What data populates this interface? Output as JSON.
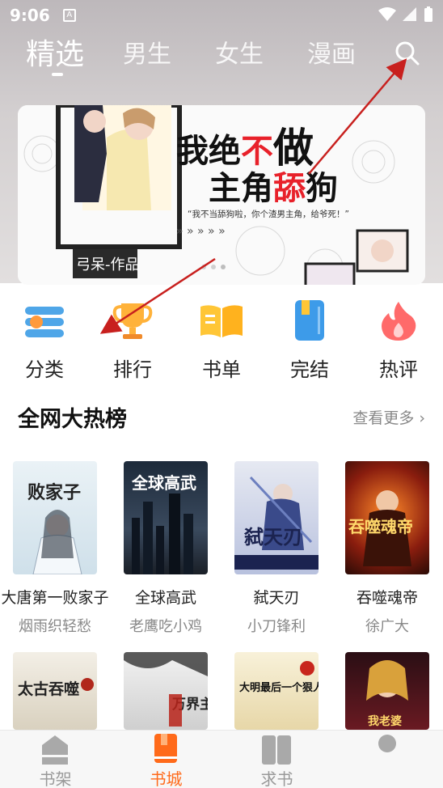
{
  "status_bar": {
    "time": "9:06",
    "notification_glyph": "A"
  },
  "top_tabs": [
    {
      "label": "精选",
      "active": true
    },
    {
      "label": "男生",
      "active": false
    },
    {
      "label": "女生",
      "active": false
    },
    {
      "label": "漫画",
      "active": false
    }
  ],
  "banner": {
    "title_line1_a": "我绝",
    "title_line1_b": "不",
    "title_line1_c": "做",
    "title_line2_a": "主角",
    "title_line2_b": "舔",
    "title_line2_c": "狗",
    "quote": "“我不当舔狗啦，你个渣男主角，给爷死！”",
    "arrows": "» » » » »",
    "author_tag": "弓呆-作品"
  },
  "categories": [
    {
      "label": "分类",
      "icon": "category-icon"
    },
    {
      "label": "排行",
      "icon": "trophy-icon"
    },
    {
      "label": "书单",
      "icon": "booklist-icon"
    },
    {
      "label": "完结",
      "icon": "completed-icon"
    },
    {
      "label": "热评",
      "icon": "hot-comment-icon"
    }
  ],
  "section": {
    "title": "全网大热榜",
    "more": "查看更多 ›"
  },
  "books_row1": [
    {
      "title": "大唐第一败家子",
      "author": "烟雨织轻愁",
      "cover_text": "败家子"
    },
    {
      "title": "全球高武",
      "author": "老鹰吃小鸡",
      "cover_text": "全球高武"
    },
    {
      "title": "弑天刃",
      "author": "小刀锋利",
      "cover_text": "弑天刃"
    },
    {
      "title": "吞噬魂帝",
      "author": "徐广大",
      "cover_text": "吞噬魂帝"
    }
  ],
  "books_row2": [
    {
      "cover_text": "太古吞噬"
    },
    {
      "cover_text": "万界主宰"
    },
    {
      "cover_text": "大明最后一个狠人"
    },
    {
      "cover_text": "我老婆"
    }
  ],
  "bottom_nav": [
    {
      "label": "书架",
      "active": false
    },
    {
      "label": "书城",
      "active": true
    },
    {
      "label": "求书",
      "active": false
    },
    {
      "label": "",
      "active": false
    }
  ],
  "colors": {
    "accent": "#ff6a1a",
    "banner_red": "#e8212a",
    "text_dark": "#222222",
    "text_gray": "#888888"
  }
}
